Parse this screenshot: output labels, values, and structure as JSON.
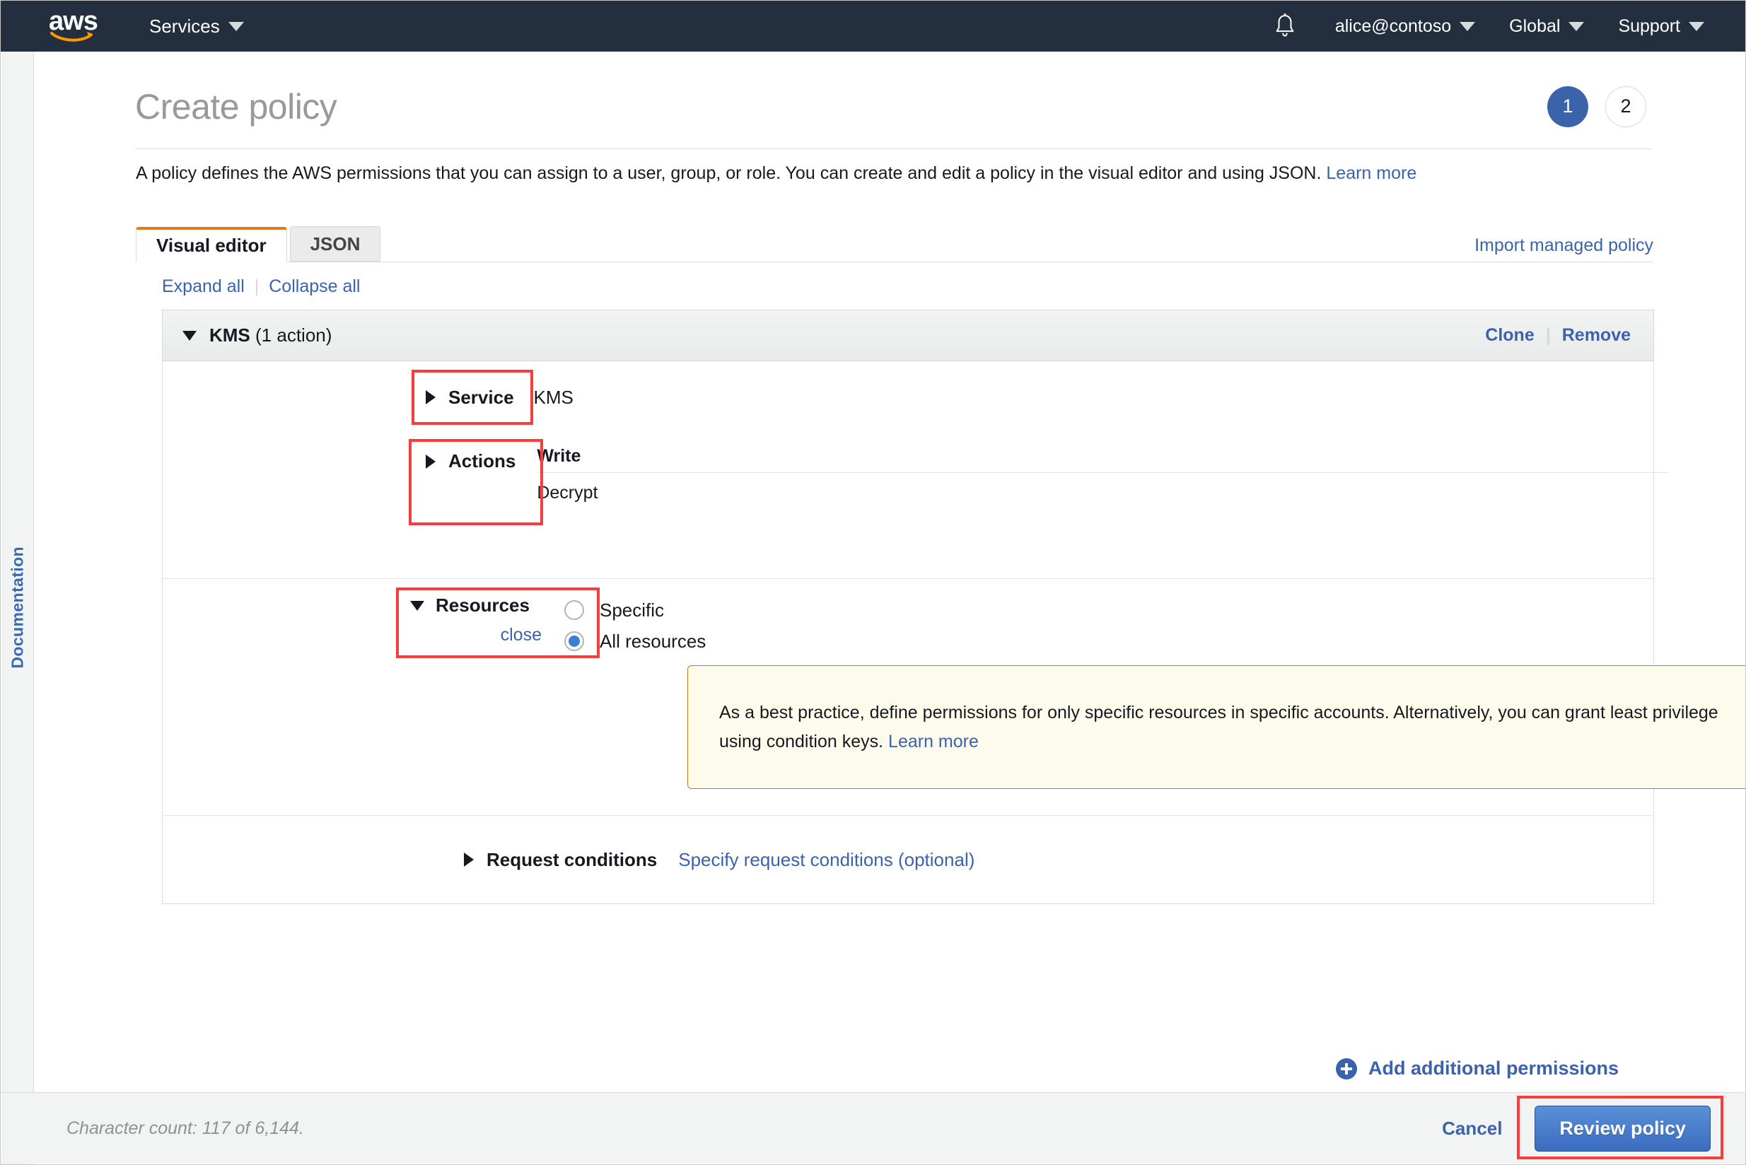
{
  "topnav": {
    "logo_text": "aws",
    "services_label": "Services",
    "bell_icon": "notification-bell-icon",
    "account_label": "alice@contoso",
    "region_label": "Global",
    "support_label": "Support"
  },
  "doc_rail": {
    "label": "Documentation"
  },
  "header": {
    "title": "Create policy",
    "steps": [
      {
        "number": "1",
        "state": "active"
      },
      {
        "number": "2",
        "state": "inactive"
      }
    ]
  },
  "intro": {
    "text": "A policy defines the AWS permissions that you can assign to a user, group, or role. You can create and edit a policy in the visual editor and using JSON.",
    "link": "Learn more"
  },
  "tabs": [
    {
      "label": "Visual editor",
      "active": true
    },
    {
      "label": "JSON",
      "active": false
    }
  ],
  "import_link": "Import managed policy",
  "tree_controls": {
    "expand_all": "Expand all",
    "separator": "|",
    "collapse_all": "Collapse all"
  },
  "permission_block": {
    "header": {
      "service_name": "KMS",
      "action_count": "(1 action)",
      "clone_label": "Clone",
      "separator": "|",
      "remove_label": "Remove"
    },
    "service": {
      "label": "Service",
      "value": "KMS"
    },
    "actions": {
      "label": "Actions",
      "group": "Write",
      "items": [
        "Decrypt"
      ]
    },
    "resources": {
      "label": "Resources",
      "close_label": "close",
      "options": [
        {
          "label": "Specific",
          "selected": false
        },
        {
          "label": "All resources",
          "selected": true
        }
      ],
      "callout": {
        "text": "As a best practice, define permissions for only specific resources in specific accounts. Alternatively, you can grant least privilege using condition keys.",
        "link": "Learn more"
      }
    },
    "request_conditions": {
      "label": "Request conditions",
      "link": "Specify request conditions (optional)"
    }
  },
  "add_permissions_label": "Add additional permissions",
  "footer": {
    "character_count": "Character count: 117 of 6,144.",
    "cancel_label": "Cancel",
    "review_label": "Review policy"
  },
  "colors": {
    "nav_bg": "#232f3e",
    "accent_orange": "#e07b22",
    "link_blue": "#3b63ab",
    "primary_button": "#3a6dbf",
    "highlight_red": "#fa3c3c",
    "callout_bg": "#fdfbec",
    "callout_border": "#c47d16"
  }
}
